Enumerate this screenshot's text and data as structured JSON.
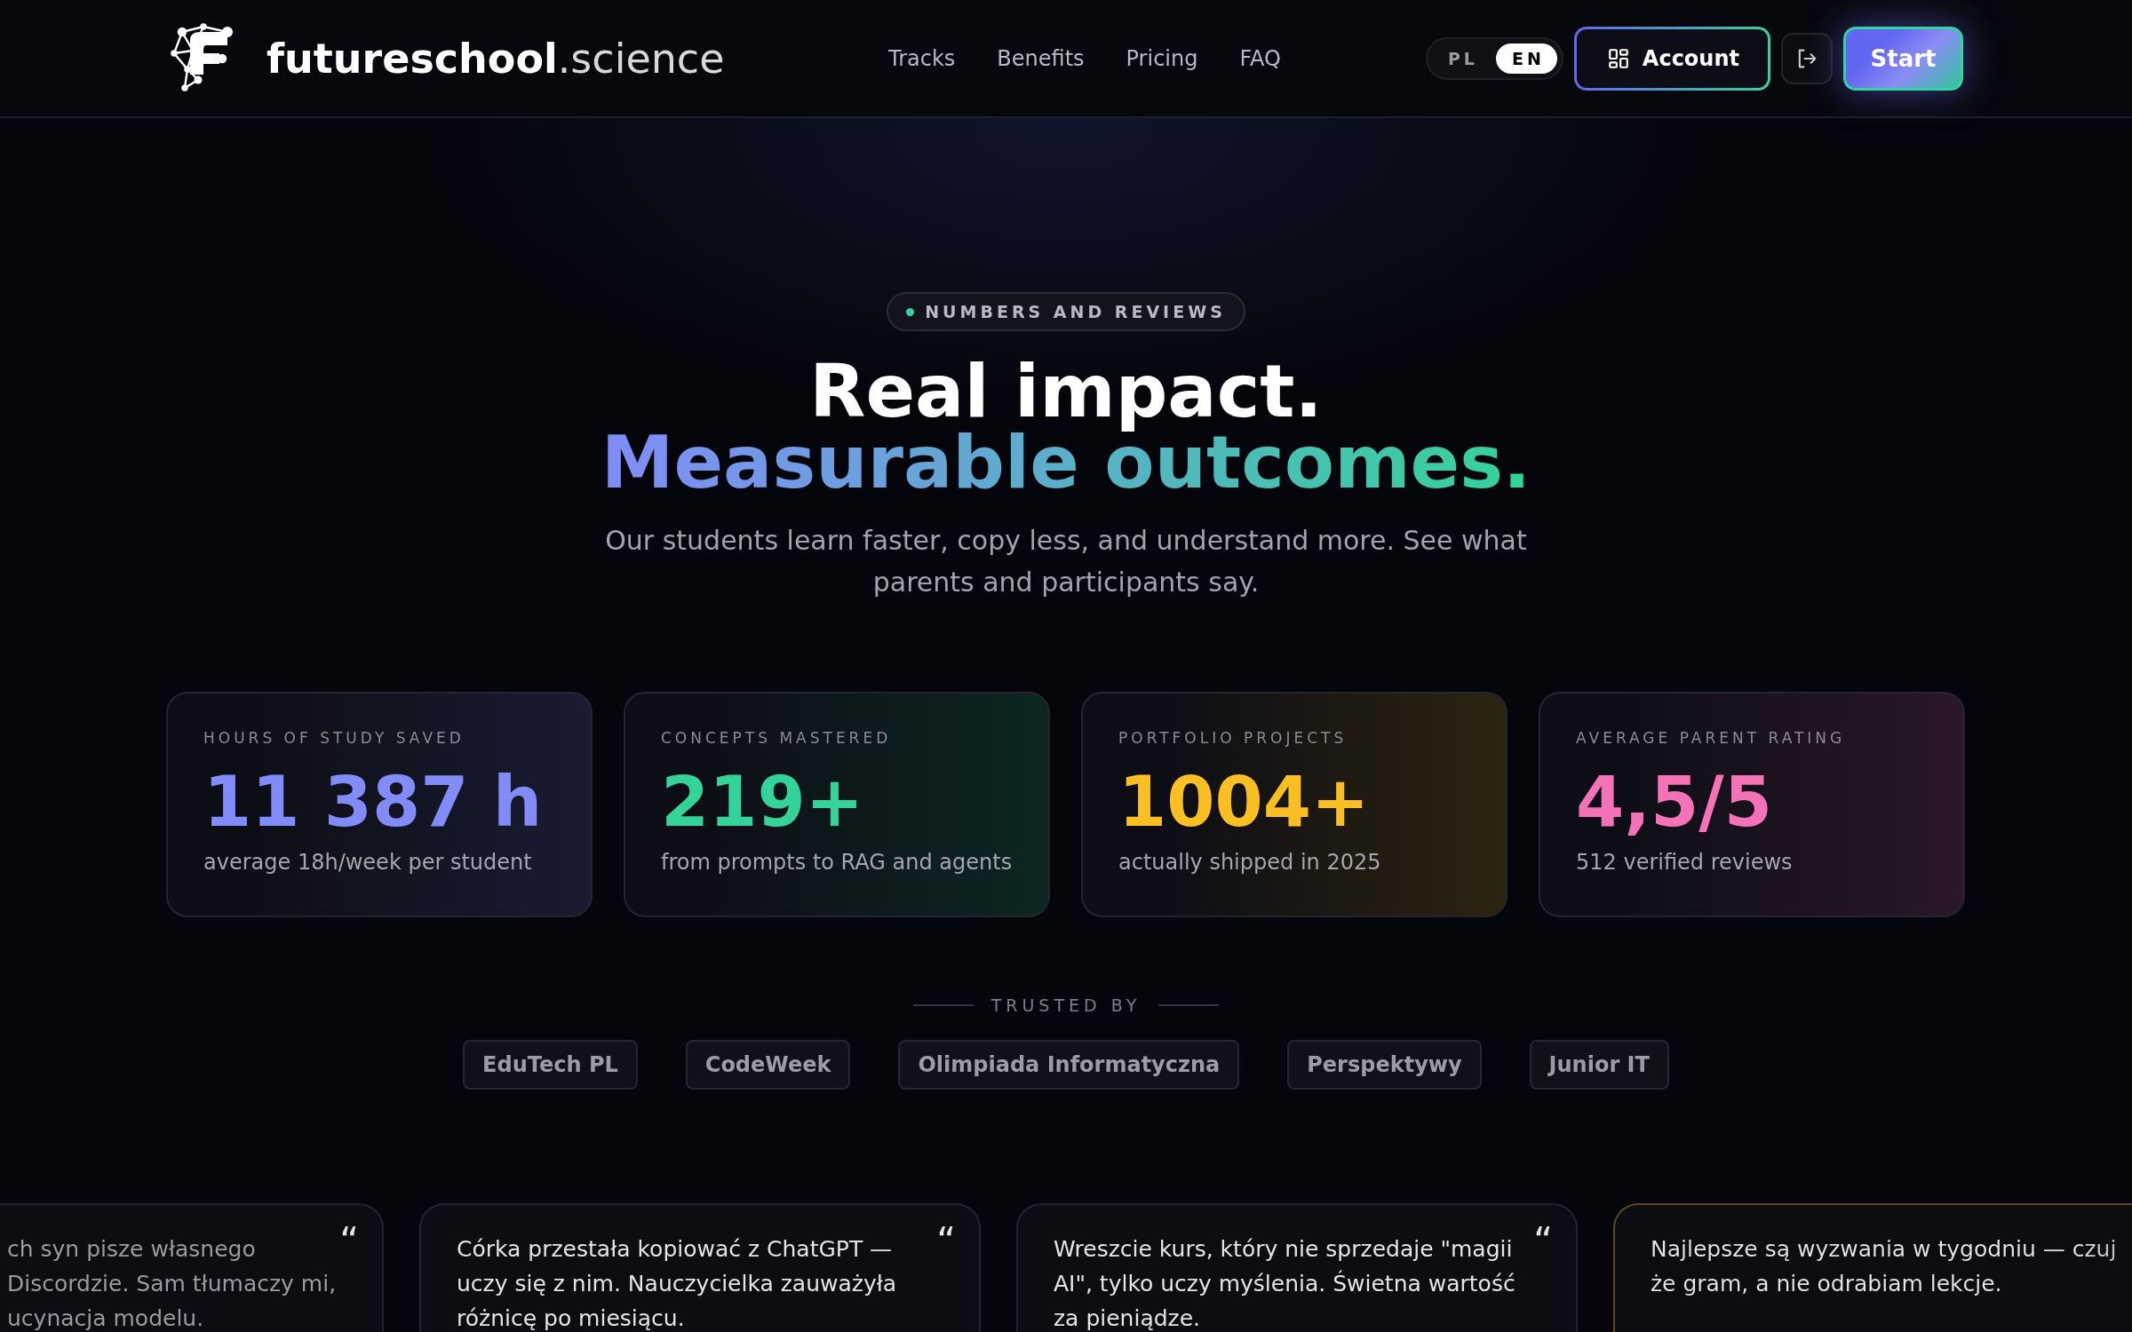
{
  "header": {
    "logo": "**futureschool**.science",
    "nav": [
      {
        "label": "Tracks"
      },
      {
        "label": "Benefits"
      },
      {
        "label": "Pricing"
      },
      {
        "label": "FAQ"
      }
    ],
    "languages": [
      {
        "label": "PL",
        "selected": false
      },
      {
        "label": "EN",
        "selected": true
      }
    ],
    "account_button": "Account",
    "start_button": "Start"
  },
  "hero": {
    "badge": "NUMBERS AND REVIEWS",
    "title": "Real impact.",
    "title_gradient": "Measurable outcomes.",
    "subtitle": "Our students learn faster, copy less, and understand more. See what parents and participants say."
  },
  "stats": [
    {
      "label": "HOURS OF STUDY SAVED",
      "value": "11 387 h",
      "note": "average 18h/week per student",
      "color": "#818cf8"
    },
    {
      "label": "CONCEPTS MASTERED",
      "value": "219+",
      "note": "from prompts to RAG and agents",
      "color": "#34d399"
    },
    {
      "label": "PORTFOLIO PROJECTS",
      "value": "1004+",
      "note": "actually shipped in 2025",
      "color": "#fbbf24"
    },
    {
      "label": "AVERAGE PARENT RATING",
      "value": "4,5/5",
      "note": "512 verified reviews",
      "color": "#f472b6"
    }
  ],
  "trusted": {
    "heading": "TRUSTED BY",
    "partners": [
      "EduTech PL",
      "CodeWeek",
      "Olimpiada Informatyczna",
      "Perspektywy",
      "Junior IT"
    ]
  },
  "testimonials": [
    {
      "lines": [
        "ch syn pisze własnego",
        "Discordzie. Sam tłumaczy mi,",
        "ucynacja modelu."
      ],
      "quote_mark": "“",
      "highlighted": false
    },
    {
      "lines": [
        "Córka przestała kopiować z ChatGPT —",
        "uczy się z nim. Nauczycielka zauważyła",
        "różnicę po miesiącu."
      ],
      "quote_mark": "“",
      "highlighted": false
    },
    {
      "lines": [
        "Wreszcie kurs, który nie sprzedaje \"magii",
        "AI\", tylko uczy myślenia. Świetna wartość",
        "za pieniądze."
      ],
      "quote_mark": "“",
      "highlighted": false
    },
    {
      "lines": [
        "Najlepsze są wyzwania w tygodniu — czuj",
        "że gram, a nie odrabiam lekcje."
      ],
      "highlighted": true
    }
  ]
}
